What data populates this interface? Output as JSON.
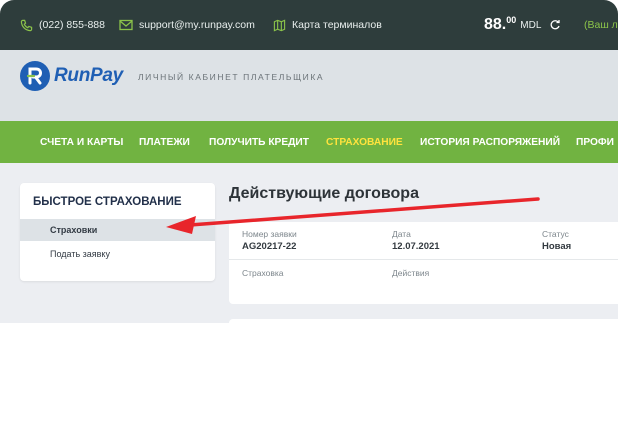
{
  "topbar": {
    "phone": "(022) 855-888",
    "email": "support@my.runpay.com",
    "terminals": "Карта терминалов",
    "balance_int": "88.",
    "balance_cents": "00",
    "currency": "MDL",
    "account_label": "(Ваш л"
  },
  "header": {
    "logo_text": "RunPay",
    "cabinet_label": "ЛИЧНЫЙ КАБИНЕТ ПЛАТЕЛЬЩИКА"
  },
  "nav": {
    "items": [
      {
        "label": "СЧЕТА И КАРТЫ"
      },
      {
        "label": "ПЛАТЕЖИ"
      },
      {
        "label": "ПОЛУЧИТЬ КРЕДИТ"
      },
      {
        "label": "СТРАХОВАНИЕ"
      },
      {
        "label": "ИСТОРИЯ РАСПОРЯЖЕНИЙ"
      },
      {
        "label": "ПРОФИ"
      }
    ]
  },
  "sidebar": {
    "title": "БЫСТРОЕ СТРАХОВАНИЕ",
    "items": [
      {
        "label": "Страховки"
      },
      {
        "label": "Подать заявку"
      }
    ]
  },
  "main": {
    "title": "Действующие договора",
    "contract": {
      "number_label": "Номер заявки",
      "number_value": "AG20217-22",
      "date_label": "Дата",
      "date_value": "12.07.2021",
      "status_label": "Статус",
      "status_value": "Новая",
      "insurance_label": "Страховка",
      "actions_label": "Действия"
    }
  },
  "colors": {
    "topbar": "#2e3d3c",
    "nav": "#71b341",
    "nav_active": "#ffe33d",
    "brand": "#1f5fb4",
    "annotation_arrow": "#e8252b"
  },
  "icons": [
    "phone-icon",
    "email-icon",
    "map-icon",
    "refresh-icon",
    "logo-mark-icon",
    "annotation-arrow"
  ]
}
